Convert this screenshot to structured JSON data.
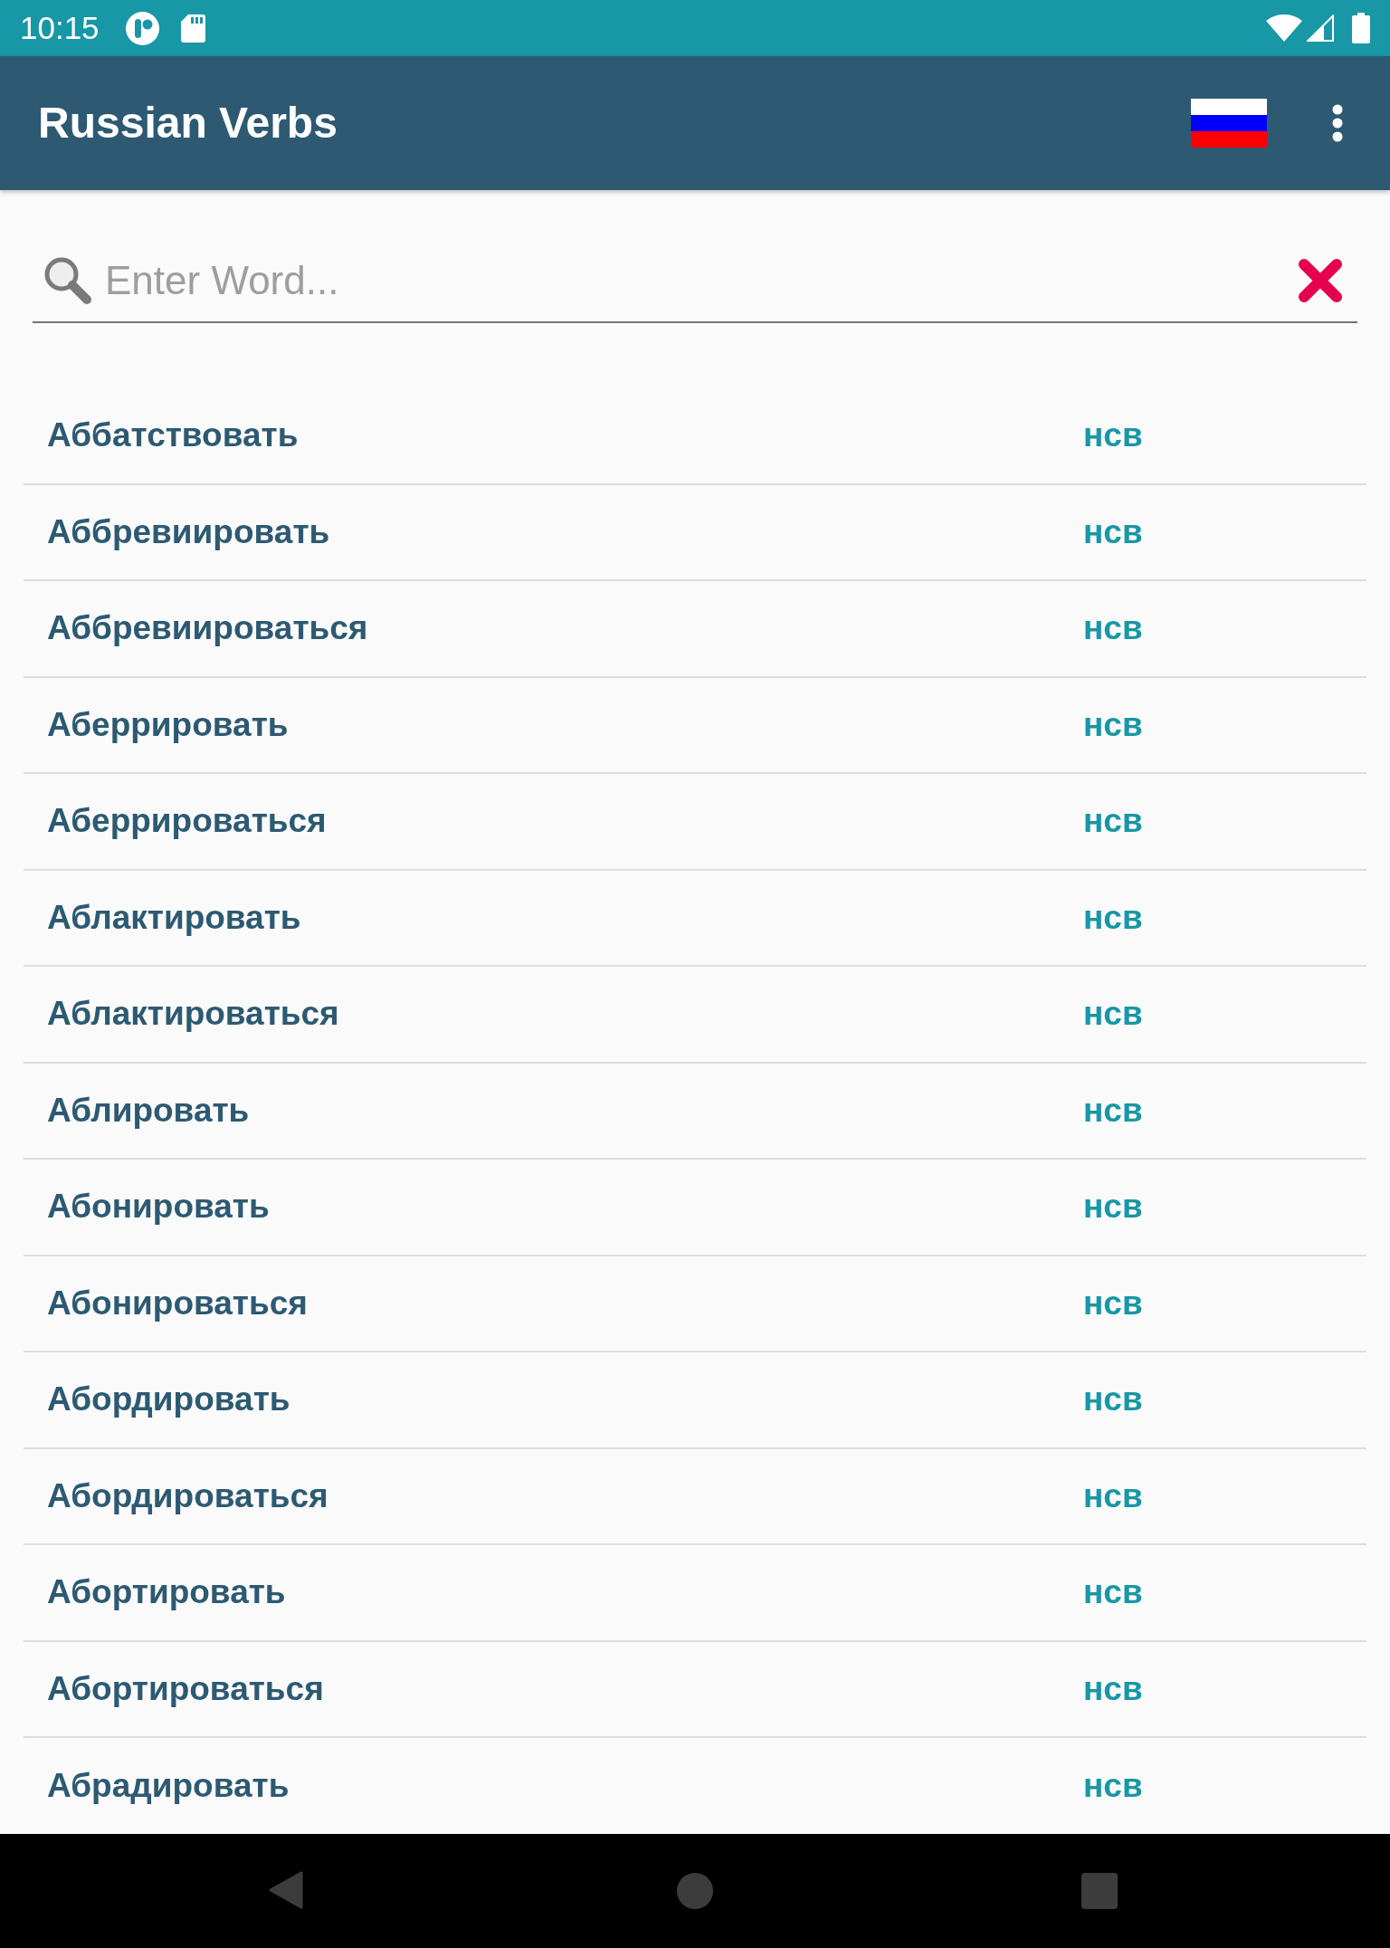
{
  "status_bar": {
    "time": "10:15"
  },
  "app_bar": {
    "title": "Russian Verbs"
  },
  "search": {
    "placeholder": "Enter Word..."
  },
  "verbs": [
    {
      "word": "Аббатствовать",
      "aspect": "нсв"
    },
    {
      "word": "Аббревиировать",
      "aspect": "нсв"
    },
    {
      "word": "Аббревиироваться",
      "aspect": "нсв"
    },
    {
      "word": "Аберрировать",
      "aspect": "нсв"
    },
    {
      "word": "Аберрироваться",
      "aspect": "нсв"
    },
    {
      "word": "Аблактировать",
      "aspect": "нсв"
    },
    {
      "word": "Аблактироваться",
      "aspect": "нсв"
    },
    {
      "word": "Аблировать",
      "aspect": "нсв"
    },
    {
      "word": "Абонировать",
      "aspect": "нсв"
    },
    {
      "word": "Абонироваться",
      "aspect": "нсв"
    },
    {
      "word": "Абордировать",
      "aspect": "нсв"
    },
    {
      "word": "Абордироваться",
      "aspect": "нсв"
    },
    {
      "word": "Абортировать",
      "aspect": "нсв"
    },
    {
      "word": "Абортироваться",
      "aspect": "нсв"
    },
    {
      "word": "Абрадировать",
      "aspect": "нсв"
    }
  ]
}
